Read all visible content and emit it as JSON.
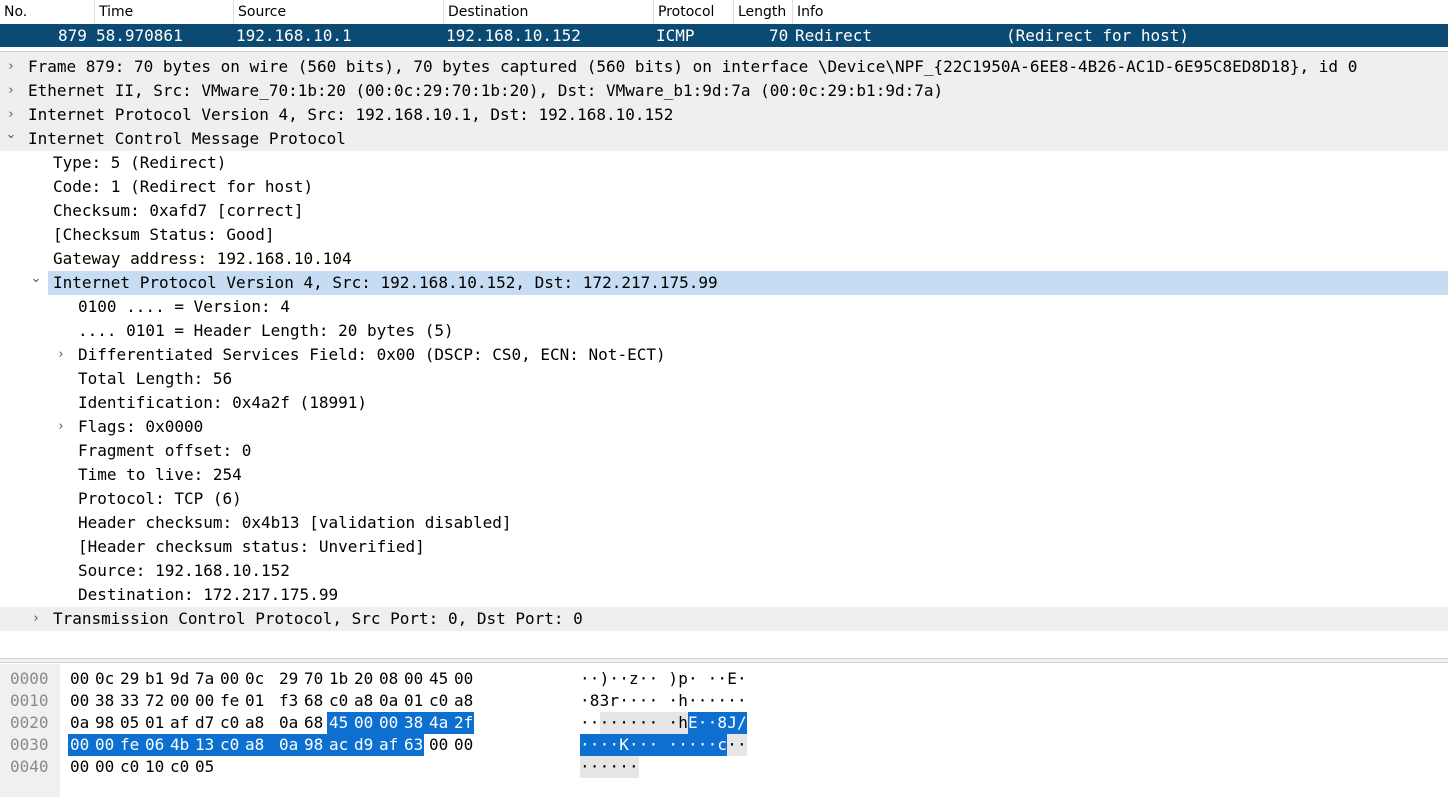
{
  "packet_list": {
    "columns": [
      "No.",
      "Time",
      "Source",
      "Destination",
      "Protocol",
      "Length",
      "Info"
    ],
    "selected_row": {
      "no": "879",
      "time": "58.970861",
      "source": "192.168.10.1",
      "destination": "192.168.10.152",
      "protocol": "ICMP",
      "length": "70",
      "info": "Redirect",
      "info_detail": "(Redirect for host)"
    }
  },
  "details": {
    "rows": [
      {
        "text": "Frame 879: 70 bytes on wire (560 bits), 70 bytes captured (560 bits) on interface \\Device\\NPF_{22C1950A-6EE8-4B26-AC1D-6E95C8ED8D18}, id 0",
        "arrow": "›"
      },
      {
        "text": "Ethernet II, Src: VMware_70:1b:20 (00:0c:29:70:1b:20), Dst: VMware_b1:9d:7a (00:0c:29:b1:9d:7a)",
        "arrow": "›"
      },
      {
        "text": "Internet Protocol Version 4, Src: 192.168.10.1, Dst: 192.168.10.152",
        "arrow": "›"
      },
      {
        "text": "Internet Control Message Protocol",
        "arrow": "⌄"
      },
      {
        "text": "Type: 5 (Redirect)",
        "arrow": ""
      },
      {
        "text": "Code: 1 (Redirect for host)",
        "arrow": ""
      },
      {
        "text": "Checksum: 0xafd7 [correct]",
        "arrow": ""
      },
      {
        "text": "[Checksum Status: Good]",
        "arrow": ""
      },
      {
        "text": "Gateway address: 192.168.10.104",
        "arrow": ""
      },
      {
        "text": "Internet Protocol Version 4, Src: 192.168.10.152, Dst: 172.217.175.99",
        "arrow": "⌄"
      },
      {
        "text": "0100 .... = Version: 4",
        "arrow": ""
      },
      {
        "text": ".... 0101 = Header Length: 20 bytes (5)",
        "arrow": ""
      },
      {
        "text": "Differentiated Services Field: 0x00 (DSCP: CS0, ECN: Not-ECT)",
        "arrow": "›"
      },
      {
        "text": "Total Length: 56",
        "arrow": ""
      },
      {
        "text": "Identification: 0x4a2f (18991)",
        "arrow": ""
      },
      {
        "text": "Flags: 0x0000",
        "arrow": "›"
      },
      {
        "text": "Fragment offset: 0",
        "arrow": ""
      },
      {
        "text": "Time to live: 254",
        "arrow": ""
      },
      {
        "text": "Protocol: TCP (6)",
        "arrow": ""
      },
      {
        "text": "Header checksum: 0x4b13 [validation disabled]",
        "arrow": ""
      },
      {
        "text": "[Header checksum status: Unverified]",
        "arrow": ""
      },
      {
        "text": "Source: 192.168.10.152",
        "arrow": ""
      },
      {
        "text": "Destination: 172.217.175.99",
        "arrow": ""
      },
      {
        "text": "Transmission Control Protocol, Src Port: 0, Dst Port: 0",
        "arrow": "›"
      }
    ]
  },
  "hex": {
    "rows": [
      {
        "offset": "0000",
        "bytes": [
          "00",
          "0c",
          "29",
          "b1",
          "9d",
          "7a",
          "00",
          "0c",
          "29",
          "70",
          "1b",
          "20",
          "08",
          "00",
          "45",
          "00"
        ],
        "ascii": [
          "·",
          "·",
          ")",
          "·",
          "·",
          "z",
          "·",
          "·",
          ")",
          "p",
          "·",
          " ",
          "·",
          "·",
          "E",
          "·"
        ]
      },
      {
        "offset": "0010",
        "bytes": [
          "00",
          "38",
          "33",
          "72",
          "00",
          "00",
          "fe",
          "01",
          "f3",
          "68",
          "c0",
          "a8",
          "0a",
          "01",
          "c0",
          "a8"
        ],
        "ascii": [
          "·",
          "8",
          "3",
          "r",
          "·",
          "·",
          "·",
          "·",
          "·",
          "h",
          "·",
          "·",
          "·",
          "·",
          "·",
          "·"
        ]
      },
      {
        "offset": "0020",
        "bytes": [
          "0a",
          "98",
          "05",
          "01",
          "af",
          "d7",
          "c0",
          "a8",
          "0a",
          "68",
          "45",
          "00",
          "00",
          "38",
          "4a",
          "2f"
        ],
        "ascii": [
          "·",
          "·",
          "·",
          "·",
          "·",
          "·",
          "·",
          "·",
          "·",
          "h",
          "E",
          "·",
          "·",
          "8",
          "J",
          "/"
        ]
      },
      {
        "offset": "0030",
        "bytes": [
          "00",
          "00",
          "fe",
          "06",
          "4b",
          "13",
          "c0",
          "a8",
          "0a",
          "98",
          "ac",
          "d9",
          "af",
          "63",
          "00",
          "00"
        ],
        "ascii": [
          "·",
          "·",
          "·",
          "·",
          "K",
          "·",
          "·",
          "·",
          "·",
          "·",
          "·",
          "·",
          "·",
          "c",
          "·",
          "·"
        ]
      },
      {
        "offset": "0040",
        "bytes": [
          "00",
          "00",
          "c0",
          "10",
          "c0",
          "05"
        ],
        "ascii": [
          "·",
          "·",
          "·",
          "·",
          "·",
          "·"
        ]
      }
    ]
  },
  "colors": {
    "selected_row_bg": "#0b4a73",
    "tree_highlight": "#c5dcf2",
    "hex_selection": "#0d6fcf"
  }
}
